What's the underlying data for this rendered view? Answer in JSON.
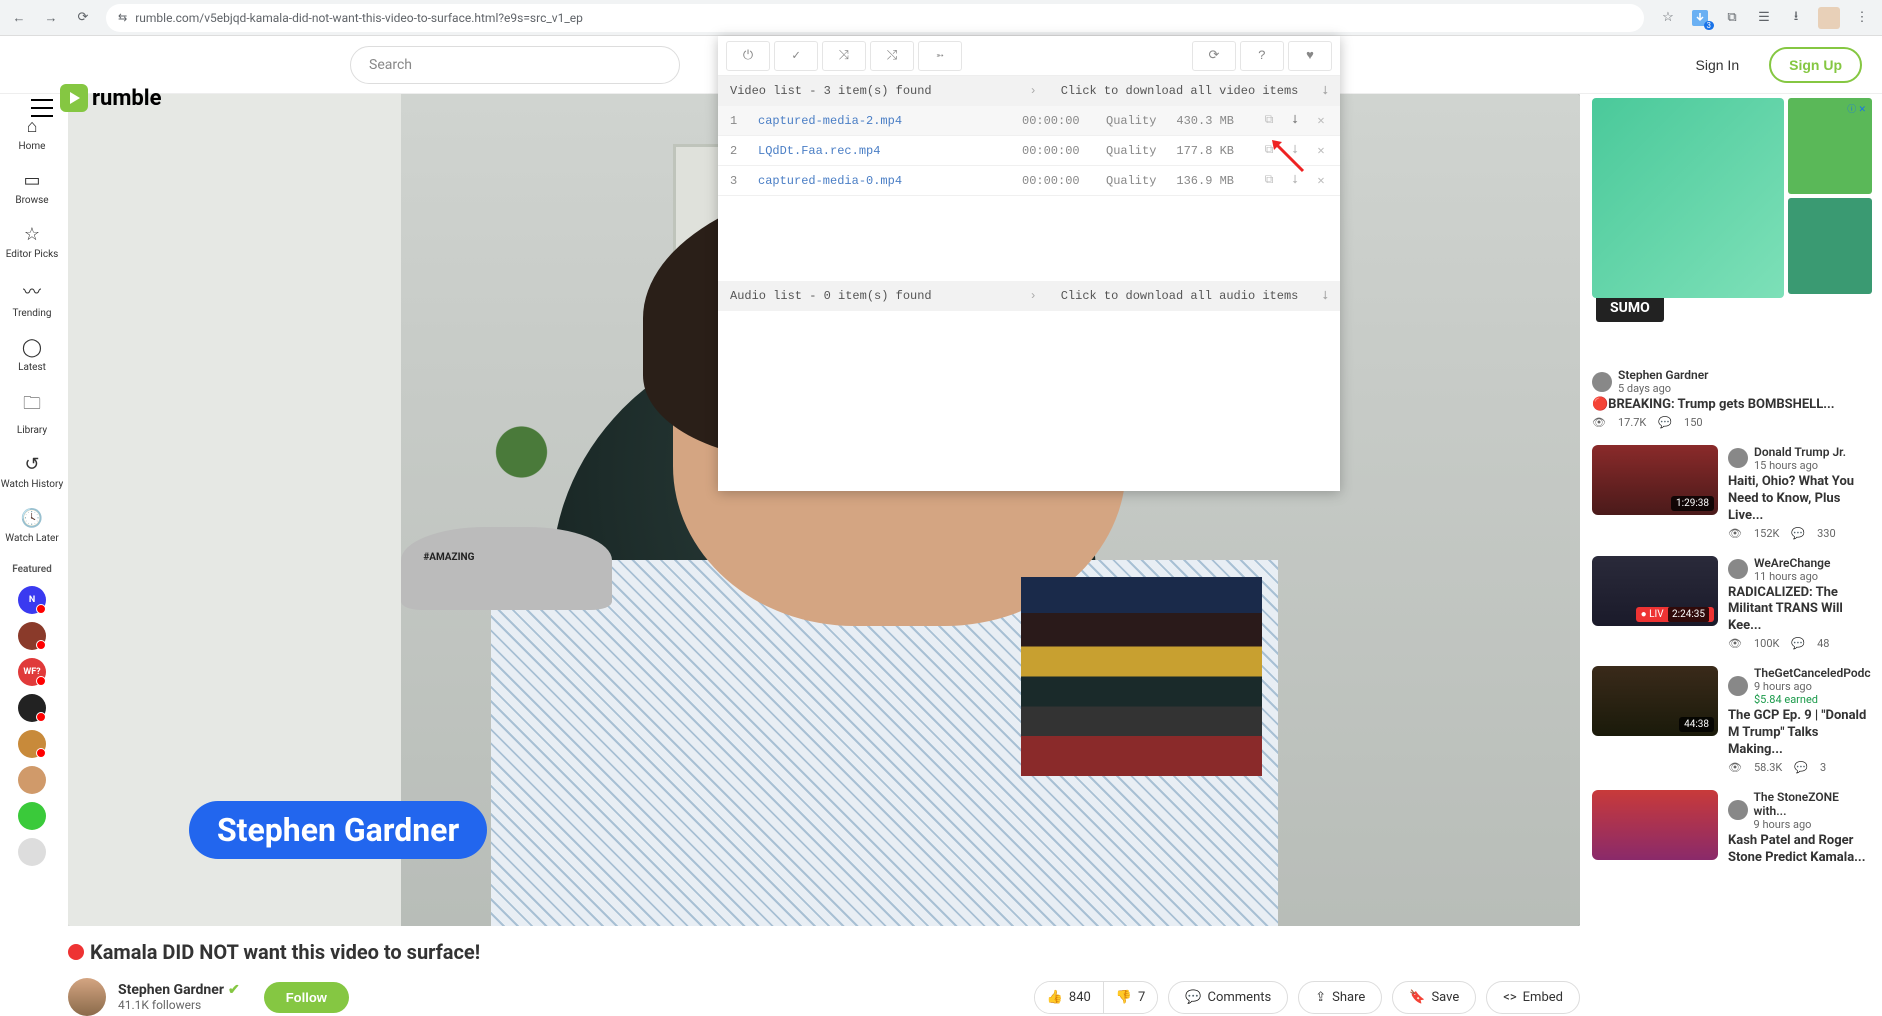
{
  "browser": {
    "url": "rumble.com/v5ebjqd-kamala-did-not-want-this-video-to-surface.html?e9s=src_v1_ep",
    "extension_badge": "3"
  },
  "topbar": {
    "logo_text": "rumble",
    "search_placeholder": "Search",
    "signin": "Sign In",
    "signup": "Sign Up"
  },
  "rail": {
    "items": [
      {
        "icon": "⌂",
        "label": "Home"
      },
      {
        "icon": "▭",
        "label": "Browse"
      },
      {
        "icon": "☆",
        "label": "Editor Picks"
      },
      {
        "icon": "〰",
        "label": "Trending"
      },
      {
        "icon": "◯",
        "label": "Latest"
      },
      {
        "icon": "🗀",
        "label": "Library"
      },
      {
        "icon": "↺",
        "label": "Watch History"
      },
      {
        "icon": "🕓",
        "label": "Watch Later"
      }
    ],
    "featured_label": "Featured"
  },
  "video": {
    "speaker_name": "Stephen Gardner",
    "cap_text": "#AMAZING",
    "title": "Kamala DID NOT want this video to surface!",
    "channel_name": "Stephen Gardner",
    "followers": "41.1K followers",
    "follow": "Follow",
    "likes": "840",
    "dislikes": "7",
    "comments": "Comments",
    "share": "Share",
    "save": "Save",
    "embed": "Embed"
  },
  "downloader": {
    "video_header": "Video list - 3 item(s) found",
    "video_action": "Click to download all video items",
    "audio_header": "Audio list - 0 item(s) found",
    "audio_action": "Click to download all audio items",
    "rows": [
      {
        "idx": "1",
        "file": "captured-media-2.mp4",
        "dur": "00:00:00",
        "q": "Quality",
        "size": "430.3 MB"
      },
      {
        "idx": "2",
        "file": "LQdDt.Faa.rec.mp4",
        "dur": "00:00:00",
        "q": "Quality",
        "size": "177.8 KB"
      },
      {
        "idx": "3",
        "file": "captured-media-0.mp4",
        "dur": "00:00:00",
        "q": "Quality",
        "size": "136.9 MB"
      }
    ]
  },
  "ads": {
    "sumo": "SUMO",
    "badge": "ⓘ ✕"
  },
  "recommended": [
    {
      "channel": "Stephen Gardner",
      "time": "5 days ago",
      "title": "🔴BREAKING: Trump gets BOMBSHELL...",
      "views": "17.7K",
      "comments": "150",
      "thumb": false,
      "dur": ""
    },
    {
      "channel": "Donald Trump Jr.",
      "time": "15 hours ago",
      "title": "Haiti, Ohio? What You Need to Know, Plus Live...",
      "views": "152K",
      "comments": "330",
      "thumb": true,
      "dur": "1:29:38"
    },
    {
      "channel": "WeAreChange",
      "time": "11 hours ago",
      "title": "RADICALIZED: The Militant TRANS Will Kee...",
      "views": "100K",
      "comments": "48",
      "thumb": true,
      "dur": "2:24:35",
      "live": true
    },
    {
      "channel": "TheGetCanceledPodc",
      "time": "9 hours ago",
      "earned": "$5.84 earned",
      "title": "The GCP Ep. 9 | \"Donald M Trump\" Talks Making...",
      "views": "58.3K",
      "comments": "3",
      "thumb": true,
      "dur": "44:38"
    },
    {
      "channel": "The StoneZONE with...",
      "time": "9 hours ago",
      "title": "Kash Patel and Roger Stone Predict Kamala...",
      "views": "",
      "comments": "",
      "thumb": true,
      "dur": ""
    }
  ]
}
